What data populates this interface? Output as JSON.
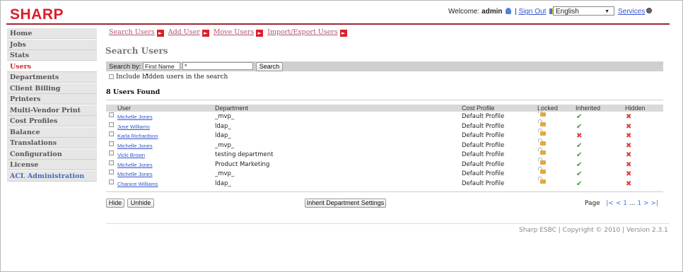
{
  "header": {
    "logo": "SHARP",
    "welcome_prefix": "Welcome: ",
    "username": "admin",
    "sign_out": "Sign Out",
    "separator": " | ",
    "language": "English",
    "services": "Services"
  },
  "sidebar": {
    "items": [
      {
        "label": "Home"
      },
      {
        "label": "Jobs"
      },
      {
        "label": "Stats"
      },
      {
        "label": "Users"
      },
      {
        "label": "Departments"
      },
      {
        "label": "Client Billing"
      },
      {
        "label": "Printers"
      },
      {
        "label": "Multi-Vendor Print"
      },
      {
        "label": "Cost Profiles"
      },
      {
        "label": "Balance"
      },
      {
        "label": "Translations"
      },
      {
        "label": "Configuration"
      },
      {
        "label": "License"
      },
      {
        "label": "ACL Administration"
      }
    ]
  },
  "subnav": {
    "search_users": "Search Users",
    "add_user": "Add User",
    "move_users": "Move Users",
    "import_export": "Import/Export Users"
  },
  "page_title": "Search Users",
  "search": {
    "label": "Search by:",
    "field": "First Name",
    "value": "*",
    "button": "Search",
    "include_hidden": "Include hidden users in the search"
  },
  "results": {
    "found": "8 Users Found",
    "columns": {
      "user": "User",
      "department": "Department",
      "cost_profile": "Cost Profile",
      "locked": "Locked",
      "inherited": "Inherited",
      "hidden": "Hidden"
    },
    "rows": [
      {
        "user": "Michelle Jones",
        "department": "_mvp_",
        "cost_profile": "Default Profile",
        "inherited": "yes",
        "hidden": "no"
      },
      {
        "user": "Jose Williams",
        "department": "ldap_",
        "cost_profile": "Default Profile",
        "inherited": "yes",
        "hidden": "no"
      },
      {
        "user": "Karla Richardson",
        "department": "ldap_",
        "cost_profile": "Default Profile",
        "inherited": "no",
        "hidden": "no"
      },
      {
        "user": "Michelle Jones",
        "department": "_mvp_",
        "cost_profile": "Default Profile",
        "inherited": "yes",
        "hidden": "no"
      },
      {
        "user": "Vicki Brown",
        "department": "testing department",
        "cost_profile": "Default Profile",
        "inherited": "yes",
        "hidden": "no"
      },
      {
        "user": "Michelle Jones",
        "department": "Product Marketing",
        "cost_profile": "Default Profile",
        "inherited": "yes",
        "hidden": "no"
      },
      {
        "user": "Michelle Jones",
        "department": "_mvp_",
        "cost_profile": "Default Profile",
        "inherited": "yes",
        "hidden": "no"
      },
      {
        "user": "Chanice Williams",
        "department": "ldap_",
        "cost_profile": "Default Profile",
        "inherited": "yes",
        "hidden": "no"
      }
    ]
  },
  "actions": {
    "hide": "Hide",
    "unhide": "Unhide",
    "inherit": "Inherit Department Settings"
  },
  "pager": {
    "label": "Page",
    "first": "|<",
    "prev": "<",
    "current": "1",
    "ellipsis": "...",
    "last_page": "1",
    "next": ">",
    "last": ">|"
  },
  "footer": "Sharp ESBC | Copyright © 2010 | Version 2.3.1",
  "colors": {
    "brand_red": "#d9202a",
    "link_blue": "#3355cc",
    "check_green": "#3e9b3e",
    "x_red": "#e04040"
  }
}
